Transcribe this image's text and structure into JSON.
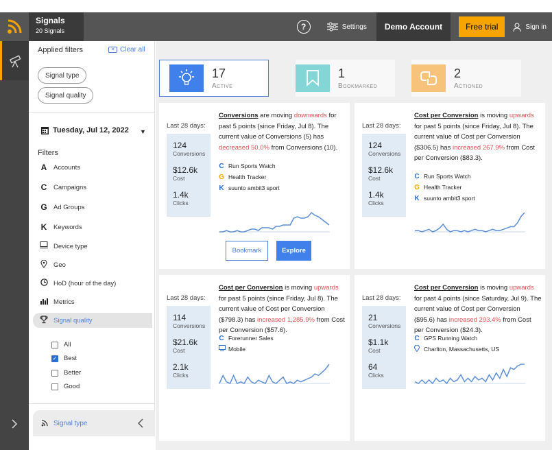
{
  "header": {
    "app_title": "Signals",
    "app_subtitle": "20 Signals",
    "settings_label": "Settings",
    "account_label": "Demo Account",
    "free_trial_label": "Free trial",
    "signin_label": "Sign in"
  },
  "filters_panel": {
    "applied_title": "Applied filters",
    "clear_all": "Clear all",
    "chips": [
      "Signal type",
      "Signal quality"
    ],
    "date": "Tuesday, Jul 12, 2022",
    "filters_title": "Filters",
    "items": [
      {
        "label": "Accounts",
        "icon": "accounts-icon"
      },
      {
        "label": "Campaigns",
        "icon": "campaigns-icon"
      },
      {
        "label": "Ad Groups",
        "icon": "ad-groups-icon"
      },
      {
        "label": "Keywords",
        "icon": "keywords-icon"
      },
      {
        "label": "Device type",
        "icon": "device-icon"
      },
      {
        "label": "Geo",
        "icon": "geo-pin-icon"
      },
      {
        "label": "HoD (hour of the day)",
        "icon": "clock-icon"
      },
      {
        "label": "Metrics",
        "icon": "metrics-icon"
      },
      {
        "label": "Signal quality",
        "icon": "trophy-icon"
      }
    ],
    "quality_options": [
      {
        "label": "All",
        "checked": false
      },
      {
        "label": "Best",
        "checked": true
      },
      {
        "label": "Better",
        "checked": false
      },
      {
        "label": "Good",
        "checked": false
      }
    ],
    "bottom_item": "Signal type"
  },
  "stats": {
    "active": {
      "count": "17",
      "label": "Active"
    },
    "bookmarked": {
      "count": "1",
      "label": "Bookmarked"
    },
    "actioned": {
      "count": "2",
      "label": "Actioned"
    }
  },
  "cards": [
    {
      "period": "Last 28 days:",
      "metrics": [
        {
          "value": "124",
          "name": "Conversions"
        },
        {
          "value": "$12.6k",
          "name": "Cost"
        },
        {
          "value": "1.4k",
          "name": "Clicks"
        }
      ],
      "desc_metric": "Conversions",
      "desc_mid": " are moving ",
      "desc_direction": "downwards",
      "desc_after": " for past 5 points (since Friday, Jul 8). The current value of Conversions (5) has ",
      "desc_change": "decreased 50.0%",
      "desc_end": " from Conversions (10).",
      "entities": [
        {
          "icon": "C",
          "label": "Run Sports Watch",
          "color": "#2d6fd1"
        },
        {
          "icon": "G",
          "label": "Health Tracker",
          "color": "#f7a400"
        },
        {
          "icon": "K",
          "label": "suunto ambit3 sport",
          "color": "#2d6fd1"
        }
      ],
      "sparkline": [
        2,
        2,
        3,
        2,
        2,
        3,
        2,
        2,
        3,
        4,
        4,
        3,
        5,
        5,
        5,
        4,
        6,
        6,
        7,
        7,
        7,
        12,
        13,
        12,
        12,
        13,
        16,
        14,
        13,
        11,
        9,
        7
      ]
    },
    {
      "period": "Last 28 days:",
      "metrics": [
        {
          "value": "124",
          "name": "Conversions"
        },
        {
          "value": "$12.6k",
          "name": "Cost"
        },
        {
          "value": "1.4k",
          "name": "Clicks"
        }
      ],
      "desc_metric": "Cost per Conversion",
      "desc_mid": " is moving ",
      "desc_direction": "upwards",
      "desc_after": " for past 5 points (since Friday, Jul 8). The current value of Cost per Conversion ($306.5) has ",
      "desc_change": "increased 267.9%",
      "desc_end": " from Cost per Conversion ($83.3).",
      "entities": [
        {
          "icon": "C",
          "label": "Run Sports Watch",
          "color": "#2d6fd1"
        },
        {
          "icon": "G",
          "label": "Health Tracker",
          "color": "#f7a400"
        },
        {
          "icon": "K",
          "label": "suunto ambit3 sport",
          "color": "#2d6fd1"
        }
      ],
      "sparkline": [
        3,
        3,
        2,
        3,
        4,
        2,
        3,
        5,
        8,
        4,
        2,
        3,
        3,
        2,
        3,
        2,
        3,
        4,
        3,
        3,
        2,
        3,
        4,
        3,
        3,
        4,
        5,
        6,
        6,
        9,
        14,
        17
      ]
    },
    {
      "period": "Last 28 days:",
      "metrics": [
        {
          "value": "114",
          "name": "Conversions"
        },
        {
          "value": "$21.6k",
          "name": "Cost"
        },
        {
          "value": "2.1k",
          "name": "Clicks"
        }
      ],
      "desc_metric": "Cost per Conversion",
      "desc_mid": " is moving ",
      "desc_direction": "upwards",
      "desc_after": " for past 5 points (since Friday, Jul 8). The current value of Cost per Conversion ($798.3) has ",
      "desc_change": "increased 1,285.9%",
      "desc_end": " from Cost per Conversion ($57.6).",
      "entities": [
        {
          "icon": "C",
          "label": "Forerunner Sales",
          "color": "#2d6fd1"
        },
        {
          "icon": "device",
          "label": "Mobile",
          "color": "#2d6fd1"
        }
      ],
      "sparkline": [
        3,
        8,
        4,
        3,
        8,
        3,
        4,
        3,
        7,
        4,
        3,
        5,
        4,
        3,
        8,
        4,
        3,
        5,
        7,
        3,
        4,
        3,
        5,
        4,
        5,
        6,
        7,
        9,
        8,
        10,
        12,
        15
      ]
    },
    {
      "period": "Last 28 days:",
      "metrics": [
        {
          "value": "21",
          "name": "Conversions"
        },
        {
          "value": "$1.1k",
          "name": "Cost"
        },
        {
          "value": "64",
          "name": "Clicks"
        }
      ],
      "desc_metric": "Cost per Conversion",
      "desc_mid": " is moving ",
      "desc_direction": "upwards",
      "desc_after": " for past 4 points (since Saturday, Jul 9). The current value of Cost per Conversion ($95.6) has ",
      "desc_change": "increased 293.4%",
      "desc_end": " from Cost per Conversion ($24.3).",
      "entities": [
        {
          "icon": "C",
          "label": "GPS Running Watch",
          "color": "#2d6fd1"
        },
        {
          "icon": "pin",
          "label": "Charlton, Massachusetts, US",
          "color": "#2d6fd1"
        }
      ],
      "sparkline": [
        4,
        3,
        5,
        3,
        5,
        3,
        6,
        4,
        5,
        3,
        6,
        4,
        5,
        8,
        4,
        6,
        4,
        7,
        5,
        6,
        4,
        8,
        5,
        9,
        6,
        11,
        7,
        12,
        11,
        13,
        14,
        14
      ]
    }
  ],
  "buttons": {
    "bookmark": "Bookmark",
    "explore": "Explore"
  },
  "colors": {
    "accent": "#3f80ea",
    "brand": "#f7a400",
    "negative": "#e05050"
  }
}
